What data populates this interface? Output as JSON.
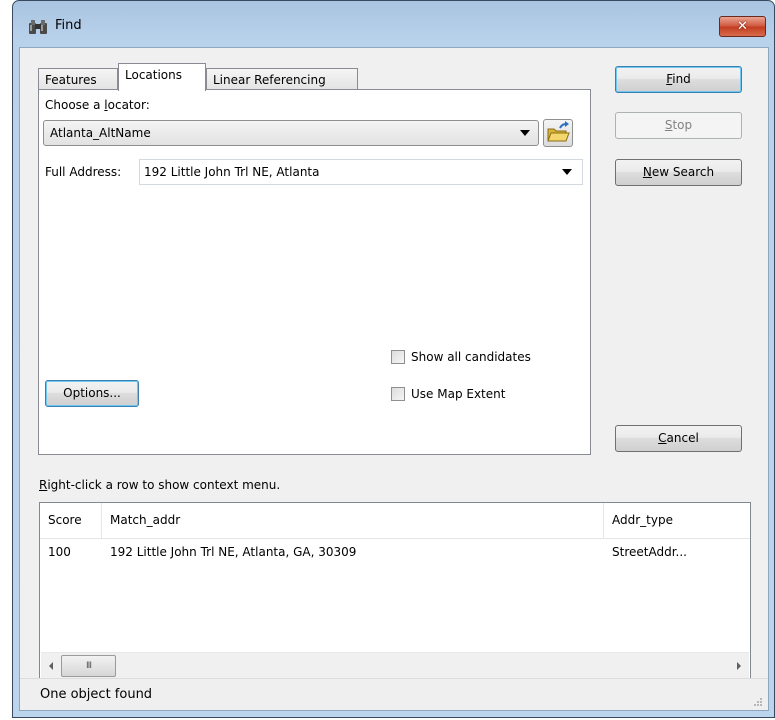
{
  "window": {
    "title": "Find",
    "title_icon": "binoculars-icon",
    "close_label": "✕"
  },
  "tabs": [
    {
      "label": "Features",
      "active": false
    },
    {
      "label": "Locations",
      "active": true
    },
    {
      "label": "Linear Referencing",
      "active": false
    }
  ],
  "locations": {
    "locator_label_pre": "Choose a ",
    "locator_label_ul": "l",
    "locator_label_post": "ocator:",
    "locator_value": "Atlanta_AltName",
    "browse_icon": "open-folder-icon",
    "full_address_label": "Full Address:",
    "full_address_value": "192 Little John Trl NE, Atlanta",
    "options_label": "Options...",
    "show_all_candidates_label": "Show all candidates",
    "show_all_candidates_checked": false,
    "use_map_extent_label": "Use Map Extent",
    "use_map_extent_checked": false
  },
  "buttons": {
    "find_ul": "F",
    "find_rest": "ind",
    "stop_ul": "S",
    "stop_rest": "top",
    "new_search_ul": "N",
    "new_search_rest": "ew Search",
    "cancel_ul": "C",
    "cancel_rest": "ancel"
  },
  "results": {
    "hint_ul": "R",
    "hint_rest": "ight-click a row to show context menu.",
    "columns": [
      "Score",
      "Match_addr",
      "Addr_type"
    ],
    "rows": [
      {
        "score": "100",
        "match_addr": "192 Little John Trl NE, Atlanta, GA, 30309",
        "addr_type": "StreetAddr..."
      }
    ],
    "scroll_thumb_glyph": "III"
  },
  "status": {
    "text": "One object found"
  },
  "colors": {
    "title_bar": "#b9d2ec",
    "close_button": "#c94a2e",
    "default_button_border": "#3c7fb1",
    "dialog_bg": "#f0f0f0"
  }
}
